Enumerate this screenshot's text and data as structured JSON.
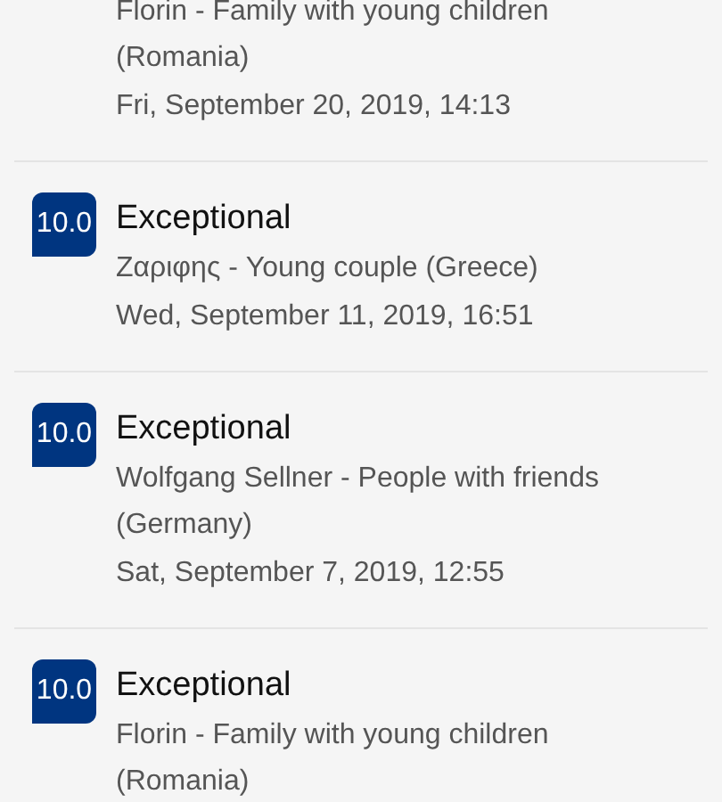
{
  "reviews": [
    {
      "reviewer": "Florin - Family with young children (Romania)",
      "date": "Fri, September 20, 2019, 14:13"
    },
    {
      "score": "10.0",
      "title": "Exceptional",
      "reviewer": "Ζαριφης - Young couple (Greece)",
      "date": "Wed, September 11, 2019, 16:51"
    },
    {
      "score": "10.0",
      "title": "Exceptional",
      "reviewer": "Wolfgang Sellner - People with friends (Germany)",
      "date": "Sat, September 7, 2019, 12:55"
    },
    {
      "score": "10.0",
      "title": "Exceptional",
      "reviewer": "Florin - Family with young children (Romania)"
    }
  ]
}
